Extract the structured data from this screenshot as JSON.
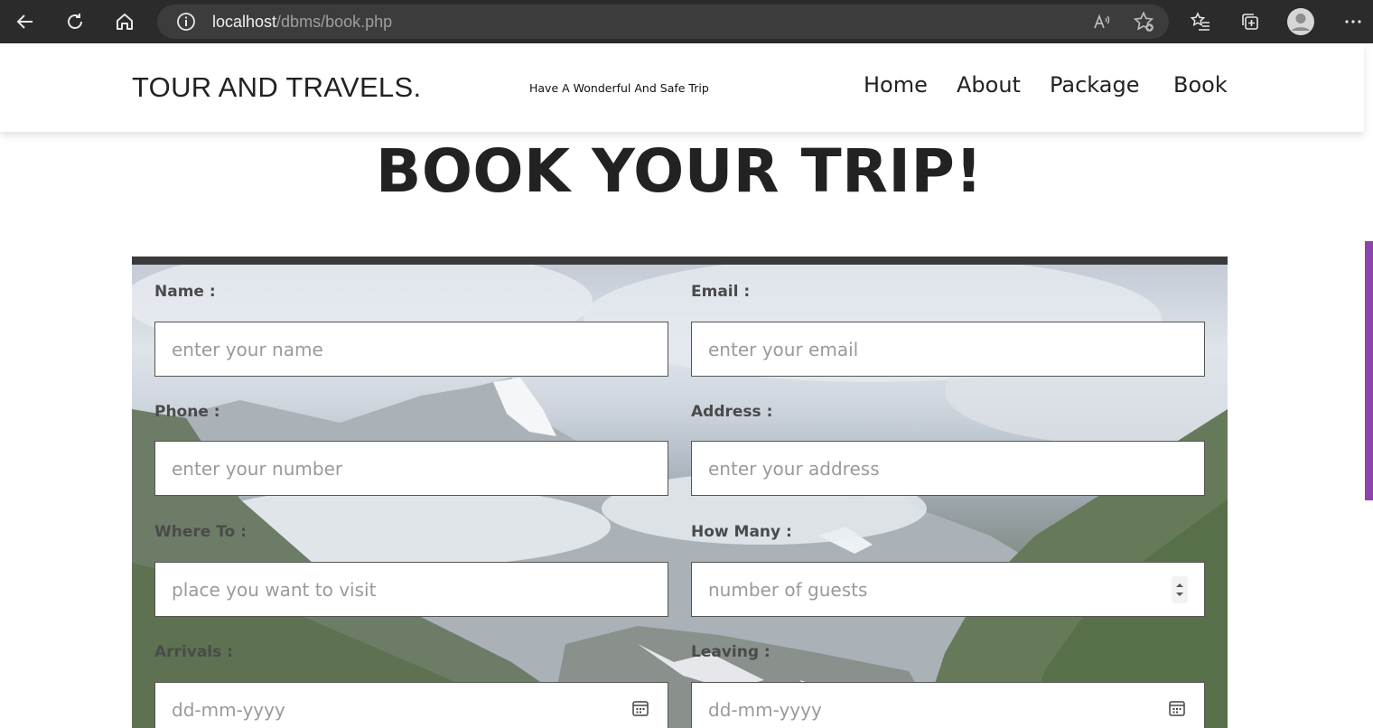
{
  "browser": {
    "url_host": "localhost",
    "url_path": "/dbms/book.php"
  },
  "site": {
    "logo": "TOUR AND TRAVELS.",
    "tagline": "Have A Wonderful And Safe Trip",
    "nav": [
      "Home",
      "About",
      "Package",
      "Book"
    ]
  },
  "page": {
    "heading": "BOOK YOUR TRIP!"
  },
  "form": {
    "name_label": "Name :",
    "name_placeholder": "enter your name",
    "email_label": "Email :",
    "email_placeholder": "enter your email",
    "phone_label": "Phone :",
    "phone_placeholder": "enter your number",
    "address_label": "Address :",
    "address_placeholder": "enter your address",
    "whereto_label": "Where To :",
    "whereto_placeholder": "place you want to visit",
    "howmany_label": "How Many :",
    "howmany_placeholder": "number of guests",
    "arrivals_label": "Arrivals :",
    "arrivals_placeholder": "dd-mm-yyyy",
    "leaving_label": "Leaving :",
    "leaving_placeholder": "dd-mm-yyyy"
  },
  "colors": {
    "accent": "#8e44ad",
    "chrome": "#2b2b2b",
    "panel_top_border": "#3a3a3a"
  }
}
